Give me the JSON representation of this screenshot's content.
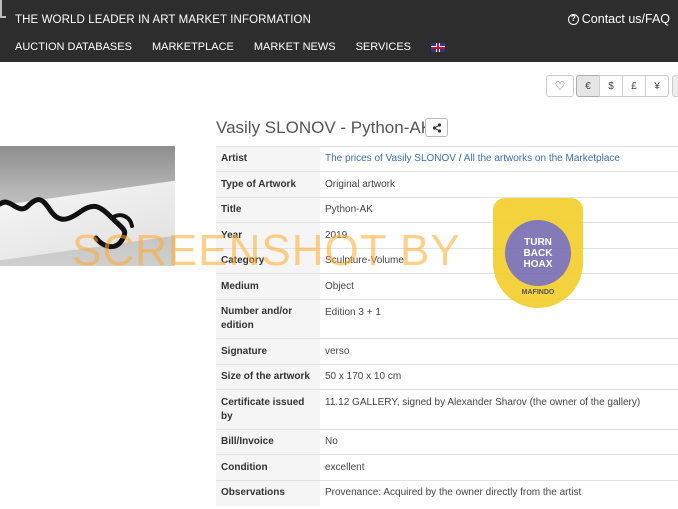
{
  "header": {
    "tagline": "THE WORLD LEADER IN ART MARKET INFORMATION",
    "contact_label": "Contact us/FAQ"
  },
  "nav": {
    "items": [
      "AUCTION DATABASES",
      "MARKETPLACE",
      "MARKET NEWS",
      "SERVICES"
    ]
  },
  "tools": {
    "currencies": [
      "€",
      "$",
      "£",
      "¥"
    ],
    "active_currency": "€"
  },
  "artwork": {
    "title": "Vasily SLONOV - Python-AK"
  },
  "details": {
    "rows": [
      {
        "key": "Artist",
        "value_link1": "The prices of Vasily SLONOV",
        "sep": " / ",
        "value_link2": "All the artworks on the Marketplace"
      },
      {
        "key": "Type of Artwork",
        "value": "Original artwork"
      },
      {
        "key": "Title",
        "value": "Python-AK"
      },
      {
        "key": "Year",
        "value": "2019"
      },
      {
        "key": "Category",
        "value": "Sculpture-Volume"
      },
      {
        "key": "Medium",
        "value": "Object"
      },
      {
        "key": "Number and/or edition",
        "value": "Edition 3 + 1"
      },
      {
        "key": "Signature",
        "value": "verso"
      },
      {
        "key": "Size of the artwork",
        "value": "50 x 170 x 10 cm"
      },
      {
        "key": "Certificate issued by",
        "value": "11.12 GALLERY, signed by Alexander Sharov (the owner of the gallery)"
      },
      {
        "key": "Bill/Invoice",
        "value": "No"
      },
      {
        "key": "Condition",
        "value": "excellent"
      },
      {
        "key": "Observations",
        "value": "Provenance: Acquired by the owner directly from the artist"
      }
    ]
  },
  "watermark": {
    "text": "SCREENSHOT BY",
    "badge_line1": "TURN",
    "badge_line2": "BACK",
    "badge_line3": "HOAX",
    "badge_brand": "MAFINDO"
  }
}
